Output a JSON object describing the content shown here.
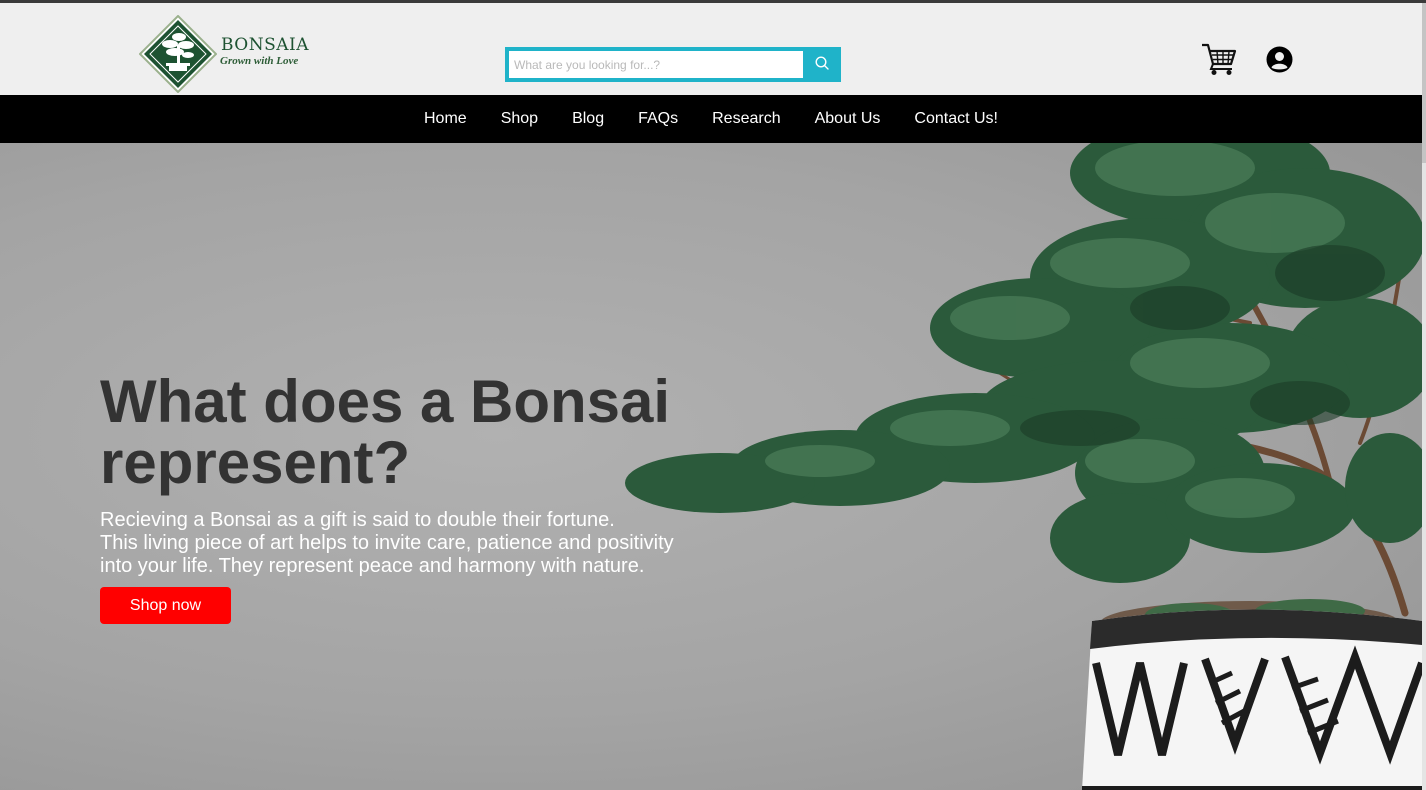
{
  "brand": {
    "name": "BONSAIA",
    "tagline": "Grown with Love",
    "color": "#1d5231",
    "logo_icon": "bonsai-tree-logo-icon"
  },
  "search": {
    "placeholder": "What are you looking for...?",
    "value": "",
    "icon": "search-icon",
    "accent": "#1fb3c9"
  },
  "header_icons": {
    "cart": "shopping-cart-icon",
    "account": "user-account-icon"
  },
  "nav": {
    "items": [
      {
        "label": "Home"
      },
      {
        "label": "Shop"
      },
      {
        "label": "Blog"
      },
      {
        "label": "FAQs"
      },
      {
        "label": "Research"
      },
      {
        "label": "About Us"
      },
      {
        "label": "Contact Us!"
      }
    ]
  },
  "hero": {
    "title": "What does a Bonsai represent?",
    "lines": [
      "Recieving a Bonsai as a gift is said to double their fortune.",
      "This living piece of art helps to invite care, patience and positivity",
      "into your life. They represent peace and harmony with nature."
    ],
    "cta_label": "Shop now",
    "cta_color": "#ff0000",
    "image": "bonsai-tree-in-patterned-pot"
  }
}
